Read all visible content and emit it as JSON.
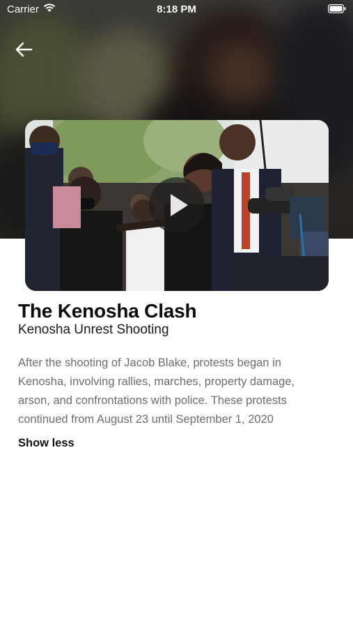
{
  "status_bar": {
    "carrier": "Carrier",
    "time": "8:18 PM",
    "icons": [
      "wifi-icon",
      "battery-icon"
    ]
  },
  "navigation": {
    "back_icon": "arrow-left-icon"
  },
  "video": {
    "play_icon": "play-icon"
  },
  "article": {
    "title": "The Kenosha Clash",
    "subtitle": "Kenosha Unrest Shooting",
    "description": "After the shooting of Jacob Blake, protests began in Kenosha, involving rallies, marches, property damage, arson, and confrontations with police. These protests continued from August 23 until September 1, 2020",
    "toggle_label": "Show less"
  },
  "colors": {
    "title": "#0b0b0b",
    "body_text": "#6e6e6e",
    "background": "#ffffff",
    "play_button_bg": "#1e1e1e"
  }
}
